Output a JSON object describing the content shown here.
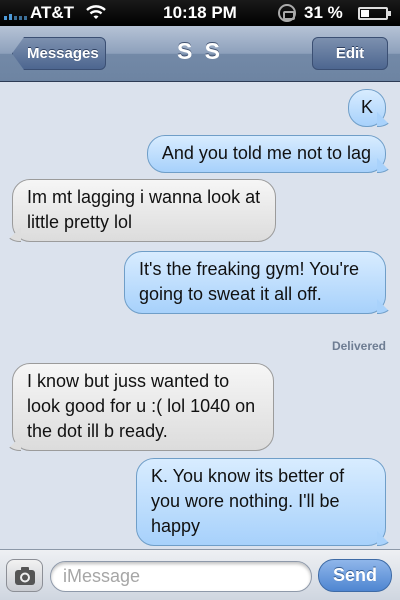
{
  "status_bar": {
    "carrier": "AT&T",
    "time": "10:18 PM",
    "battery": "31 %",
    "icons": [
      "signal-icon",
      "wifi-icon",
      "rotation-lock-icon",
      "battery-icon"
    ]
  },
  "nav": {
    "back_label": "Messages",
    "title": "S S",
    "edit_label": "Edit"
  },
  "messages": [
    {
      "direction": "out",
      "text": "K"
    },
    {
      "direction": "out",
      "text": "And you told me not to lag"
    },
    {
      "direction": "in",
      "text": "Im mt lagging i wanna look at little pretty lol"
    },
    {
      "direction": "out",
      "text": "It's the freaking gym! You're going to sweat it all off."
    },
    {
      "direction": "in",
      "text": "I know but juss wanted to look good for u :( lol 1040 on the dot ill b ready."
    },
    {
      "direction": "out",
      "text": "K. You know its better of you wore nothing. I'll be happy"
    }
  ],
  "delivered_label": "Delivered",
  "composer": {
    "placeholder": "iMessage",
    "value": "",
    "send_label": "Send",
    "camera_icon": "camera-icon"
  },
  "colors": {
    "outgoing_bubble": "#a7d1fb",
    "incoming_bubble": "#dcdcdc",
    "background": "#dbe2ed",
    "send_button": "#4f86d1"
  }
}
